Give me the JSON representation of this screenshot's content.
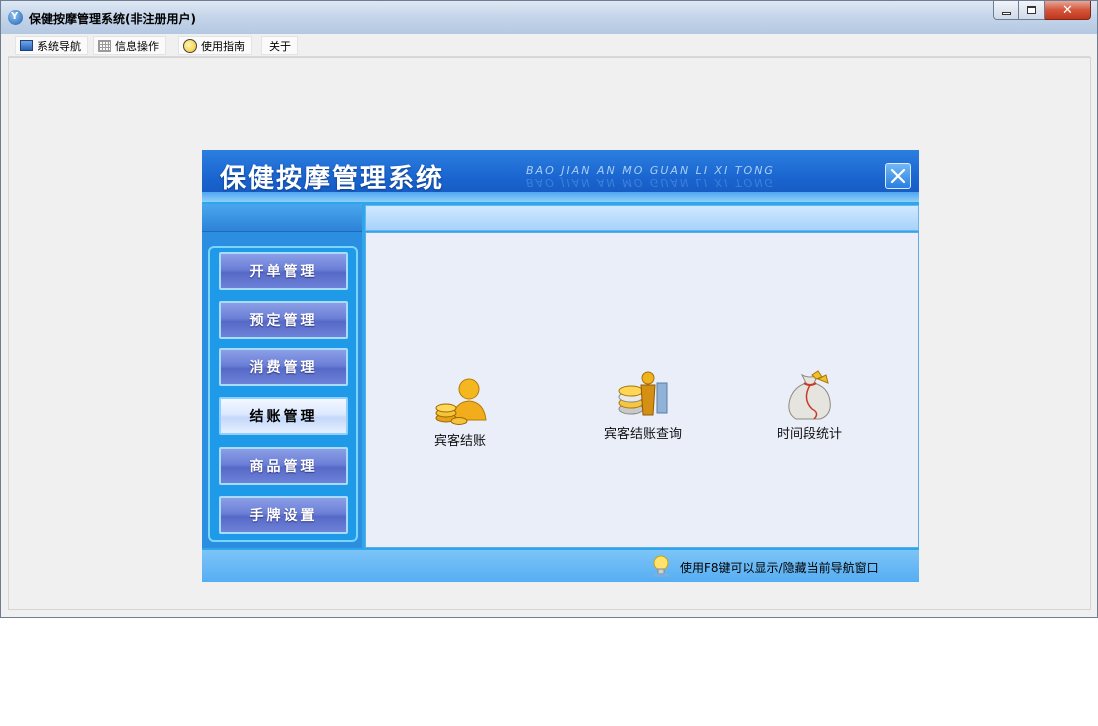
{
  "window": {
    "title": "保健按摩管理系统(非注册用户)",
    "app_icon_glyph": "Y",
    "controls": {
      "minimize": "minimize-icon",
      "maximize": "restore-icon",
      "close": "✕"
    }
  },
  "menu": {
    "items": [
      {
        "label": "系统导航",
        "icon": "monitor-icon"
      },
      {
        "label": "信息操作",
        "icon": "grid-icon"
      },
      {
        "label": "使用指南",
        "icon": "lightbulb-icon"
      },
      {
        "label": "关于",
        "icon": ""
      }
    ]
  },
  "nav_panel": {
    "title": "保健按摩管理系统",
    "pinyin": "BAO JIAN AN MO GUAN LI XI TONG",
    "side_buttons": [
      {
        "label": "开单管理",
        "active": false
      },
      {
        "label": "预定管理",
        "active": false
      },
      {
        "label": "消费管理",
        "active": false
      },
      {
        "label": "结账管理",
        "active": true
      },
      {
        "label": "商品管理",
        "active": false
      },
      {
        "label": "手牌设置",
        "active": false
      }
    ],
    "functions": [
      {
        "label": "宾客结账",
        "icon": "guest-checkout-icon"
      },
      {
        "label": "宾客结账查询",
        "icon": "checkout-query-icon"
      },
      {
        "label": "时间段统计",
        "icon": "money-bag-icon"
      }
    ],
    "footer_tip": "使用F8键可以显示/隐藏当前导航窗口"
  },
  "colors": {
    "header_blue": "#1a64cf",
    "panel_blue": "#2fa6ea",
    "button_purple": "#6b7fd7",
    "content_bg": "#e9eef8"
  }
}
